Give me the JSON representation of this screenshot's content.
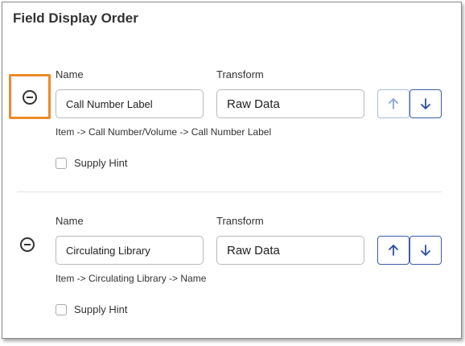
{
  "title": "Field Display Order",
  "fields": [
    {
      "name_label": "Name",
      "name_value": "Call Number Label",
      "transform_label": "Transform",
      "transform_value": "Raw Data",
      "path": "Item -> Call Number/Volume -> Call Number Label",
      "supply_hint_label": "Supply Hint",
      "supply_hint_checked": false,
      "remove_highlighted": true,
      "move_up_enabled": false,
      "move_down_enabled": true
    },
    {
      "name_label": "Name",
      "name_value": "Circulating Library",
      "transform_label": "Transform",
      "transform_value": "Raw Data",
      "path": "Item -> Circulating Library -> Name",
      "supply_hint_label": "Supply Hint",
      "supply_hint_checked": false,
      "remove_highlighted": false,
      "move_up_enabled": true,
      "move_down_enabled": true
    }
  ],
  "icons": {
    "remove": "minus-circle-icon",
    "up": "arrow-up-icon",
    "down": "arrow-down-icon"
  },
  "colors": {
    "highlight": "#ee8a2a",
    "button_border": "#3a5ea8",
    "button_icon": "#2b4f9e",
    "button_disabled_border": "#a9bcdf",
    "button_disabled_icon": "#8aa6d8"
  }
}
